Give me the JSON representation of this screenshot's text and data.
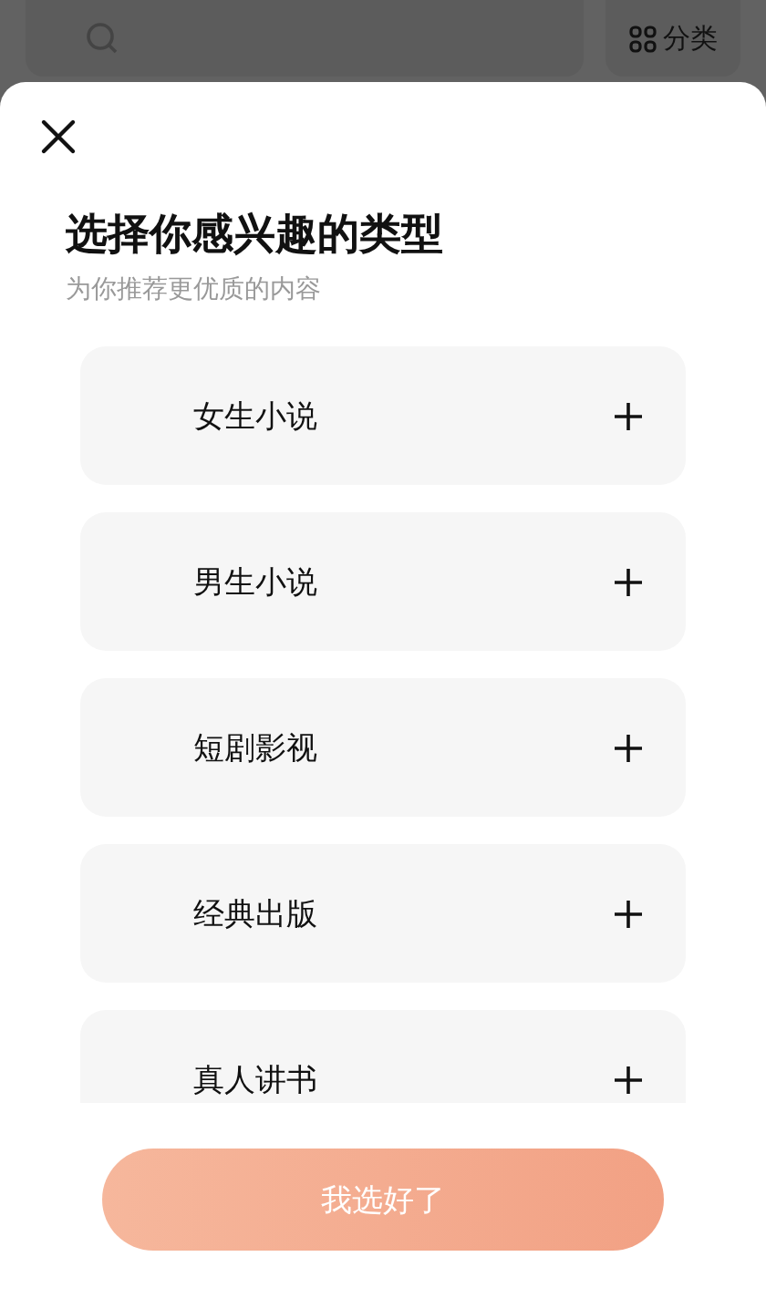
{
  "top_bar": {
    "category_button": "分类"
  },
  "sheet": {
    "title": "选择你感兴趣的类型",
    "subtitle": "为你推荐更优质的内容",
    "options": [
      {
        "label": "女生小说",
        "selected": false
      },
      {
        "label": "男生小说",
        "selected": false
      },
      {
        "label": "短剧影视",
        "selected": false
      },
      {
        "label": "经典出版",
        "selected": false
      },
      {
        "label": "真人讲书",
        "selected": false
      }
    ],
    "confirm_button": {
      "label": "我选好了",
      "disabled": true
    }
  }
}
